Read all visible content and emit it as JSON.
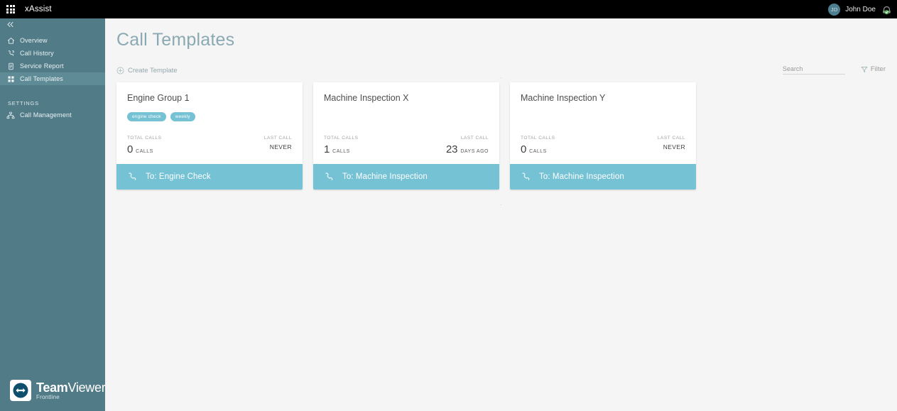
{
  "topbar": {
    "launcher_icon": "apps-grid-icon",
    "app_title": "xAssist",
    "user_initials": "JD",
    "user_name": "John Doe",
    "support_icon": "support-status-icon",
    "background_color": "#000000"
  },
  "sidebar": {
    "background_color": "#507b87",
    "active_color": "#5e8b96",
    "collapse_icon": "chevron-double-left-icon",
    "items": [
      {
        "label": "Overview",
        "icon": "home-icon",
        "active": false
      },
      {
        "label": "Call History",
        "icon": "phone-history-icon",
        "active": false
      },
      {
        "label": "Service Report",
        "icon": "document-icon",
        "active": false
      },
      {
        "label": "Call Templates",
        "icon": "grid-template-icon",
        "active": true
      }
    ],
    "settings_label": "SETTINGS",
    "settings_items": [
      {
        "label": "Call Management",
        "icon": "org-chart-icon",
        "active": false
      }
    ],
    "brand": {
      "name_bold": "Team",
      "name_light": "Viewer",
      "subtitle": "Frontline",
      "mark_icon": "teamviewer-arrows-icon"
    }
  },
  "main": {
    "page_title": "Call Templates",
    "create_label": "Create Template",
    "create_icon": "plus-circle-icon",
    "search_placeholder": "Search",
    "search_value": "",
    "filter_label": "Filter",
    "filter_icon": "funnel-icon",
    "top_marker": "·",
    "bottom_marker": "·",
    "accent_color": "#74c2d4",
    "cards": [
      {
        "title": "Engine Group 1",
        "tags": [
          "engine check",
          "weekly"
        ],
        "total_calls_label": "TOTAL CALLS",
        "total_calls_value": "0",
        "total_calls_unit": "CALLS",
        "last_call_label": "LAST CALL",
        "last_call_value": "",
        "last_call_unit": "NEVER",
        "action_label": "To: Engine Check",
        "action_icon": "phone-handset-icon"
      },
      {
        "title": "Machine Inspection X",
        "tags": [],
        "total_calls_label": "TOTAL CALLS",
        "total_calls_value": "1",
        "total_calls_unit": "CALLS",
        "last_call_label": "LAST CALL",
        "last_call_value": "23",
        "last_call_unit": "DAYS AGO",
        "action_label": "To: Machine Inspection",
        "action_icon": "phone-handset-icon"
      },
      {
        "title": "Machine Inspection Y",
        "tags": [],
        "total_calls_label": "TOTAL CALLS",
        "total_calls_value": "0",
        "total_calls_unit": "CALLS",
        "last_call_label": "LAST CALL",
        "last_call_value": "",
        "last_call_unit": "NEVER",
        "action_label": "To: Machine Inspection",
        "action_icon": "phone-handset-icon"
      }
    ]
  }
}
